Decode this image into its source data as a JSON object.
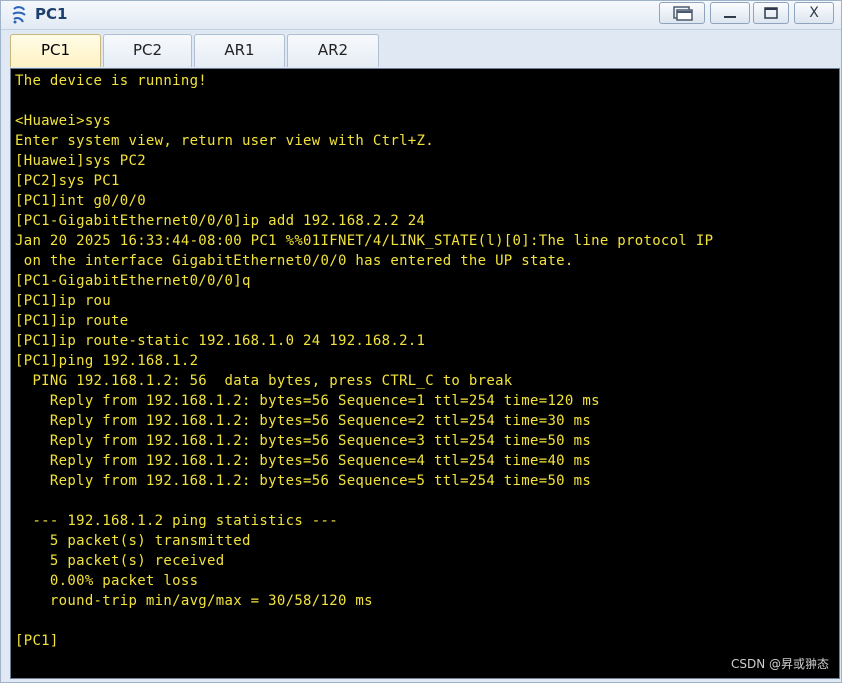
{
  "window": {
    "title": "PC1",
    "controls": [
      "restore",
      "minimize",
      "maximize",
      "close"
    ],
    "close_label": "X"
  },
  "tabs": [
    {
      "label": "PC1",
      "active": true
    },
    {
      "label": "PC2",
      "active": false
    },
    {
      "label": "AR1",
      "active": false
    },
    {
      "label": "AR2",
      "active": false
    }
  ],
  "terminal": {
    "text_color": "#f2e33c",
    "background": "#000000",
    "lines": [
      "The device is running!",
      "",
      "<Huawei>sys",
      "Enter system view, return user view with Ctrl+Z.",
      "[Huawei]sys PC2",
      "[PC2]sys PC1",
      "[PC1]int g0/0/0",
      "[PC1-GigabitEthernet0/0/0]ip add 192.168.2.2 24",
      "Jan 20 2025 16:33:44-08:00 PC1 %%01IFNET/4/LINK_STATE(l)[0]:The line protocol IP",
      " on the interface GigabitEthernet0/0/0 has entered the UP state.",
      "[PC1-GigabitEthernet0/0/0]q",
      "[PC1]ip rou",
      "[PC1]ip route",
      "[PC1]ip route-static 192.168.1.0 24 192.168.2.1",
      "[PC1]ping 192.168.1.2",
      "  PING 192.168.1.2: 56  data bytes, press CTRL_C to break",
      "    Reply from 192.168.1.2: bytes=56 Sequence=1 ttl=254 time=120 ms",
      "    Reply from 192.168.1.2: bytes=56 Sequence=2 ttl=254 time=30 ms",
      "    Reply from 192.168.1.2: bytes=56 Sequence=3 ttl=254 time=50 ms",
      "    Reply from 192.168.1.2: bytes=56 Sequence=4 ttl=254 time=40 ms",
      "    Reply from 192.168.1.2: bytes=56 Sequence=5 ttl=254 time=50 ms",
      "",
      "  --- 192.168.1.2 ping statistics ---",
      "    5 packet(s) transmitted",
      "    5 packet(s) received",
      "    0.00% packet loss",
      "    round-trip min/avg/max = 30/58/120 ms",
      "",
      "[PC1]"
    ]
  },
  "watermark": "CSDN @昇或翀态"
}
